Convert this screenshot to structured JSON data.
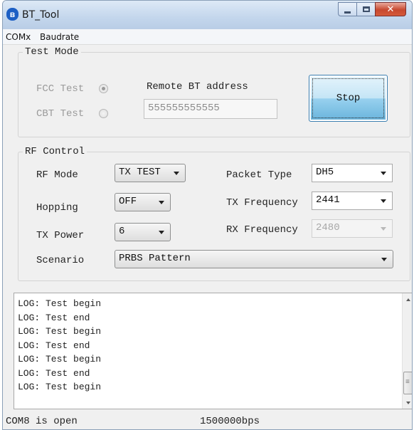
{
  "window": {
    "title": "BT_Tool"
  },
  "menu": {
    "items": [
      "COMx",
      "Baudrate"
    ]
  },
  "test_mode": {
    "legend": "Test Mode",
    "fcc_label": "FCC Test",
    "cbt_label": "CBT Test",
    "remote_label": "Remote BT address",
    "remote_value": "555555555555",
    "stop_label": "Stop"
  },
  "rf_control": {
    "legend": "RF Control",
    "rf_mode_label": "RF Mode",
    "rf_mode_value": "TX TEST",
    "hopping_label": "Hopping",
    "hopping_value": "OFF",
    "tx_power_label": "TX Power",
    "tx_power_value": "6",
    "scenario_label": "Scenario",
    "scenario_value": "PRBS Pattern",
    "packet_type_label": "Packet Type",
    "packet_type_value": "DH5",
    "tx_freq_label": "TX Frequency",
    "tx_freq_value": "2441",
    "rx_freq_label": "RX Frequency",
    "rx_freq_value": "2480"
  },
  "log": {
    "lines": [
      "LOG: Test begin",
      "LOG: Test end",
      "LOG: Test begin",
      "LOG: Test end",
      "LOG: Test begin",
      "LOG: Test end",
      "LOG: Test begin"
    ]
  },
  "status": {
    "port": "COM8 is open",
    "baud": "1500000bps"
  }
}
